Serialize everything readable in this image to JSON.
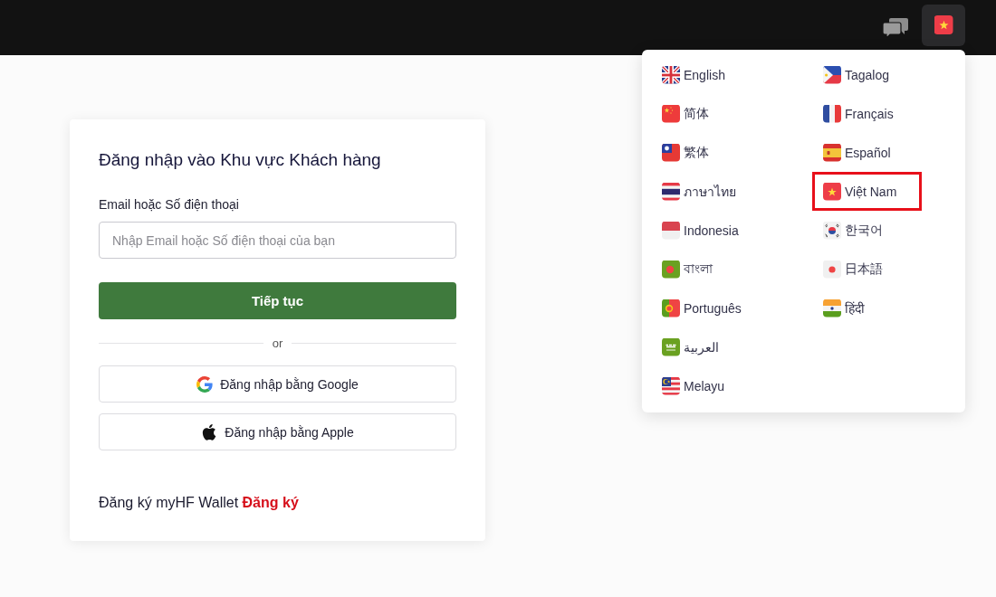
{
  "language_menu": {
    "columns": [
      {
        "items": [
          {
            "kind": "gb",
            "label": "English",
            "selected": false
          },
          {
            "kind": "cn",
            "label": "简体",
            "selected": false
          },
          {
            "kind": "tw",
            "label": "繁体",
            "selected": false
          },
          {
            "kind": "th",
            "label": "ภาษาไทย",
            "selected": false
          },
          {
            "kind": "id",
            "label": "Indonesia",
            "selected": false
          },
          {
            "kind": "bd",
            "label": "বাংলা",
            "selected": false
          },
          {
            "kind": "pt",
            "label": "Português",
            "selected": false
          },
          {
            "kind": "sa",
            "label": "العربية",
            "selected": false
          },
          {
            "kind": "my",
            "label": "Melayu",
            "selected": false
          }
        ]
      },
      {
        "items": [
          {
            "kind": "ph",
            "label": "Tagalog",
            "selected": false
          },
          {
            "kind": "fr",
            "label": "Français",
            "selected": false
          },
          {
            "kind": "es",
            "label": "Español",
            "selected": false
          },
          {
            "kind": "vn",
            "label": "Việt Nam",
            "selected": true
          },
          {
            "kind": "kr",
            "label": "한국어",
            "selected": false
          },
          {
            "kind": "jp",
            "label": "日本語",
            "selected": false
          },
          {
            "kind": "in",
            "label": "हिंदी",
            "selected": false
          }
        ]
      }
    ]
  },
  "login_card": {
    "title": "Đăng nhập vào Khu vực Khách hàng",
    "email_label": "Email hoặc Số điện thoại",
    "email_field": {
      "placeholder": "Nhập Email hoặc Số điện thoại của bạn"
    },
    "continue_button": "Tiếp tục",
    "divider_text": "or",
    "social_buttons": [
      {
        "kind": "google",
        "label": "Đăng nhập bằng Google"
      },
      {
        "kind": "apple",
        "label": "Đăng nhập bằng Apple"
      }
    ],
    "register": {
      "text": "Đăng ký myHF Wallet",
      "link": "Đăng ký"
    }
  }
}
